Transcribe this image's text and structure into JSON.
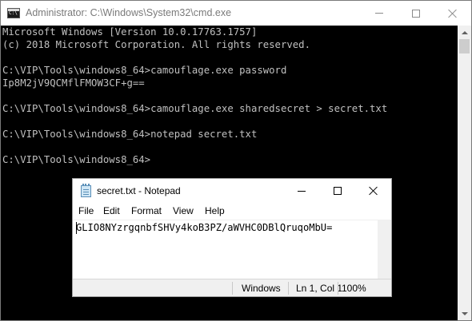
{
  "cmd": {
    "title": "Administrator: C:\\Windows\\System32\\cmd.exe",
    "lines": [
      "Microsoft Windows [Version 10.0.17763.1757]",
      "(c) 2018 Microsoft Corporation. All rights reserved.",
      "",
      "C:\\VIP\\Tools\\windows8_64>camouflage.exe password",
      "Ip8M2jV9QCMflFMOW3CF+g==",
      "",
      "C:\\VIP\\Tools\\windows8_64>camouflage.exe sharedsecret > secret.txt",
      "",
      "C:\\VIP\\Tools\\windows8_64>notepad secret.txt",
      "",
      "C:\\VIP\\Tools\\windows8_64>"
    ]
  },
  "notepad": {
    "title": "secret.txt - Notepad",
    "menu": {
      "file": "File",
      "edit": "Edit",
      "format": "Format",
      "view": "View",
      "help": "Help"
    },
    "content": "GLIO8NYzrgqnbfSHVy4koB3PZ/aWVHC0DBlQruqoMbU=",
    "status": {
      "eol": "Windows",
      "position": "Ln 1, Col 1",
      "zoom": "100%"
    }
  }
}
